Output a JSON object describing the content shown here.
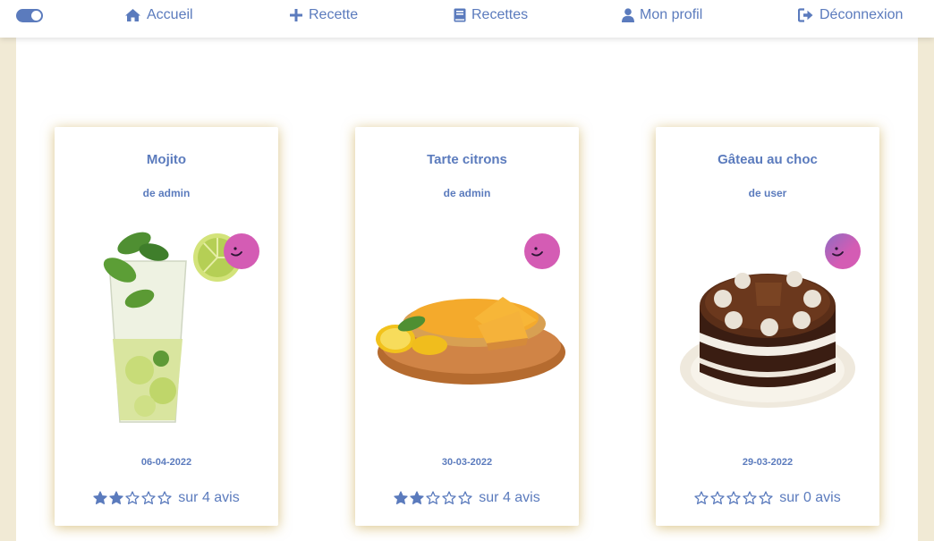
{
  "nav": {
    "home": "Accueil",
    "new_recipe": "Recette",
    "recipes": "Recettes",
    "profile": "Mon profil",
    "logout": "Déconnexion",
    "icons": [
      "toggle-icon",
      "home-icon",
      "plus-icon",
      "book-icon",
      "user-icon",
      "sign-out-icon"
    ]
  },
  "colors": {
    "accent": "#5b7bbd",
    "background": "#f1ead5",
    "avatar": "#d45cb4",
    "card_shadow": "#be9628"
  },
  "recipes": [
    {
      "title": "Mojito",
      "author": "de admin",
      "date": "06-04-2022",
      "rating": 2,
      "max_rating": 5,
      "reviews": "sur 4 avis",
      "image": "mojito-glass"
    },
    {
      "title": "Tarte citrons",
      "author": "de admin",
      "date": "30-03-2022",
      "rating": 2,
      "max_rating": 5,
      "reviews": "sur 4 avis",
      "image": "lemon-tart"
    },
    {
      "title": "Gâteau au choc",
      "author": "de user",
      "date": "29-03-2022",
      "rating": 0,
      "max_rating": 5,
      "reviews": "sur 0 avis",
      "image": "chocolate-cake"
    }
  ]
}
